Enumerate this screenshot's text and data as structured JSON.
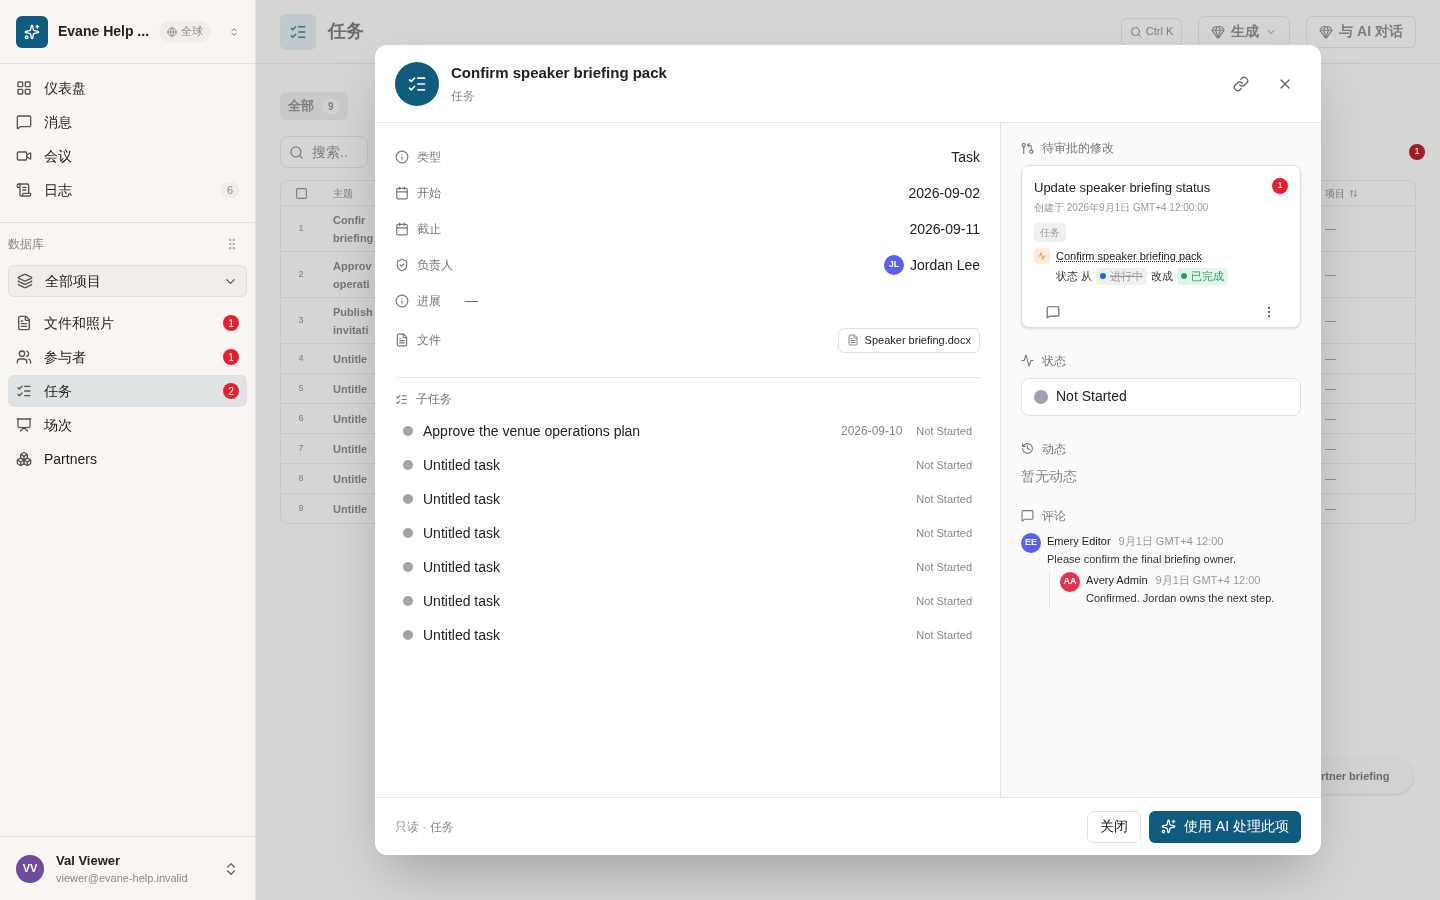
{
  "sidebar": {
    "workspace": "Evane Help ...",
    "scope": "全球",
    "nav": [
      {
        "label": "仪表盘",
        "selected": false
      },
      {
        "label": "消息",
        "selected": false
      },
      {
        "label": "会议",
        "selected": false
      },
      {
        "label": "日志",
        "selected": false,
        "count": "6"
      }
    ],
    "section_label": "数据库",
    "collection": "全部项目",
    "items": [
      {
        "label": "文件和照片",
        "selected": false,
        "badge": "1"
      },
      {
        "label": "参与者",
        "selected": false,
        "badge": "1"
      },
      {
        "label": "任务",
        "selected": true,
        "badge": "2"
      },
      {
        "label": "场次",
        "selected": false
      },
      {
        "label": "Partners",
        "selected": false
      }
    ],
    "user": {
      "initials": "VV",
      "name": "Val Viewer",
      "email": "viewer@evane-help.invalid"
    }
  },
  "page": {
    "title": "任务",
    "shortcut": "Ctrl K",
    "generate_button": "生成",
    "chat_button": "与 AI 对话",
    "tabs": [
      {
        "label": "全部",
        "count": "9",
        "selected": true
      }
    ],
    "search": {
      "placeholder": "搜索.."
    },
    "alert_badge": "1",
    "table": {
      "columns": [
        "主题",
        "项目"
      ],
      "header_checked": false,
      "rows": [
        {
          "number": "1",
          "subject": [
            "Confir",
            "briefing"
          ],
          "project": "—"
        },
        {
          "number": "2",
          "subject": [
            "Approv",
            "operati"
          ],
          "project": "—"
        },
        {
          "number": "3",
          "subject": [
            "Publish",
            "invitati"
          ],
          "project": "—"
        },
        {
          "number": "4",
          "subject": [
            "Untitle"
          ],
          "project": "—"
        },
        {
          "number": "5",
          "subject": [
            "Untitle"
          ],
          "project": "—"
        },
        {
          "number": "6",
          "subject": [
            "Untitle"
          ],
          "project": "—"
        },
        {
          "number": "7",
          "subject": [
            "Untitle"
          ],
          "project": "—"
        },
        {
          "number": "8",
          "subject": [
            "Untitle"
          ],
          "project": "—"
        },
        {
          "number": "9",
          "subject": [
            "Untitle"
          ],
          "project": "—"
        }
      ]
    },
    "floating_button": "rtner briefing"
  },
  "dialog": {
    "title": "Confirm speaker briefing pack",
    "subtitle": "任务",
    "fields": [
      {
        "kind": "text",
        "label": "类型",
        "value": "Task"
      },
      {
        "kind": "date",
        "label": "开始",
        "value": "2026-09-02"
      },
      {
        "kind": "date",
        "label": "截止",
        "value": "2026-09-11"
      },
      {
        "kind": "person",
        "label": "负责人",
        "initials": "JL",
        "value": "Jordan Lee"
      },
      {
        "kind": "empty",
        "label": "进展",
        "value": "—"
      },
      {
        "kind": "file",
        "label": "文件",
        "value": "Speaker briefing.docx"
      }
    ],
    "subtasks_label": "子任务",
    "subtasks": [
      {
        "title": "Approve the venue operations plan",
        "due": "2026-09-10",
        "status": "Not Started"
      },
      {
        "title": "Untitled task",
        "status": "Not Started"
      },
      {
        "title": "Untitled task",
        "status": "Not Started"
      },
      {
        "title": "Untitled task",
        "status": "Not Started"
      },
      {
        "title": "Untitled task",
        "status": "Not Started"
      },
      {
        "title": "Untitled task",
        "status": "Not Started"
      },
      {
        "title": "Untitled task",
        "status": "Not Started"
      }
    ],
    "pending": {
      "label": "待审批的修改",
      "title": "Update speaker briefing status",
      "badge": "1",
      "created": "创建于 2026年9月1日 GMT+4 12:00:00",
      "tag": "任务",
      "target": "Confirm speaker briefing pack",
      "from_label": "状态 从",
      "from": {
        "text": "进行中",
        "color": "#1d6ae5"
      },
      "to_label": "改成",
      "to": {
        "text": "已完成",
        "color": "#22a55b"
      }
    },
    "status": {
      "label": "状态",
      "value": "Not Started",
      "color": "#9ca3af"
    },
    "activity": {
      "label": "动态",
      "empty": "暂无动态"
    },
    "comments": {
      "label": "评论",
      "items": [
        {
          "initials": "EE",
          "author": "Emery Editor",
          "time": "9月1日 GMT+4 12:00",
          "text": "Please confirm the final briefing owner.",
          "color": "#5b5ff0",
          "replies": [
            {
              "initials": "AA",
              "author": "Avery Admin",
              "time": "9月1日 GMT+4 12:00",
              "text": "Confirmed. Jordan owns the next step.",
              "color": "#e5304f"
            }
          ]
        }
      ]
    },
    "footer": "只读 · 任务",
    "buttons": [
      {
        "label": "关闭",
        "kind": "secondary"
      },
      {
        "label": "使用 AI 处理此项",
        "kind": "primary"
      }
    ]
  }
}
